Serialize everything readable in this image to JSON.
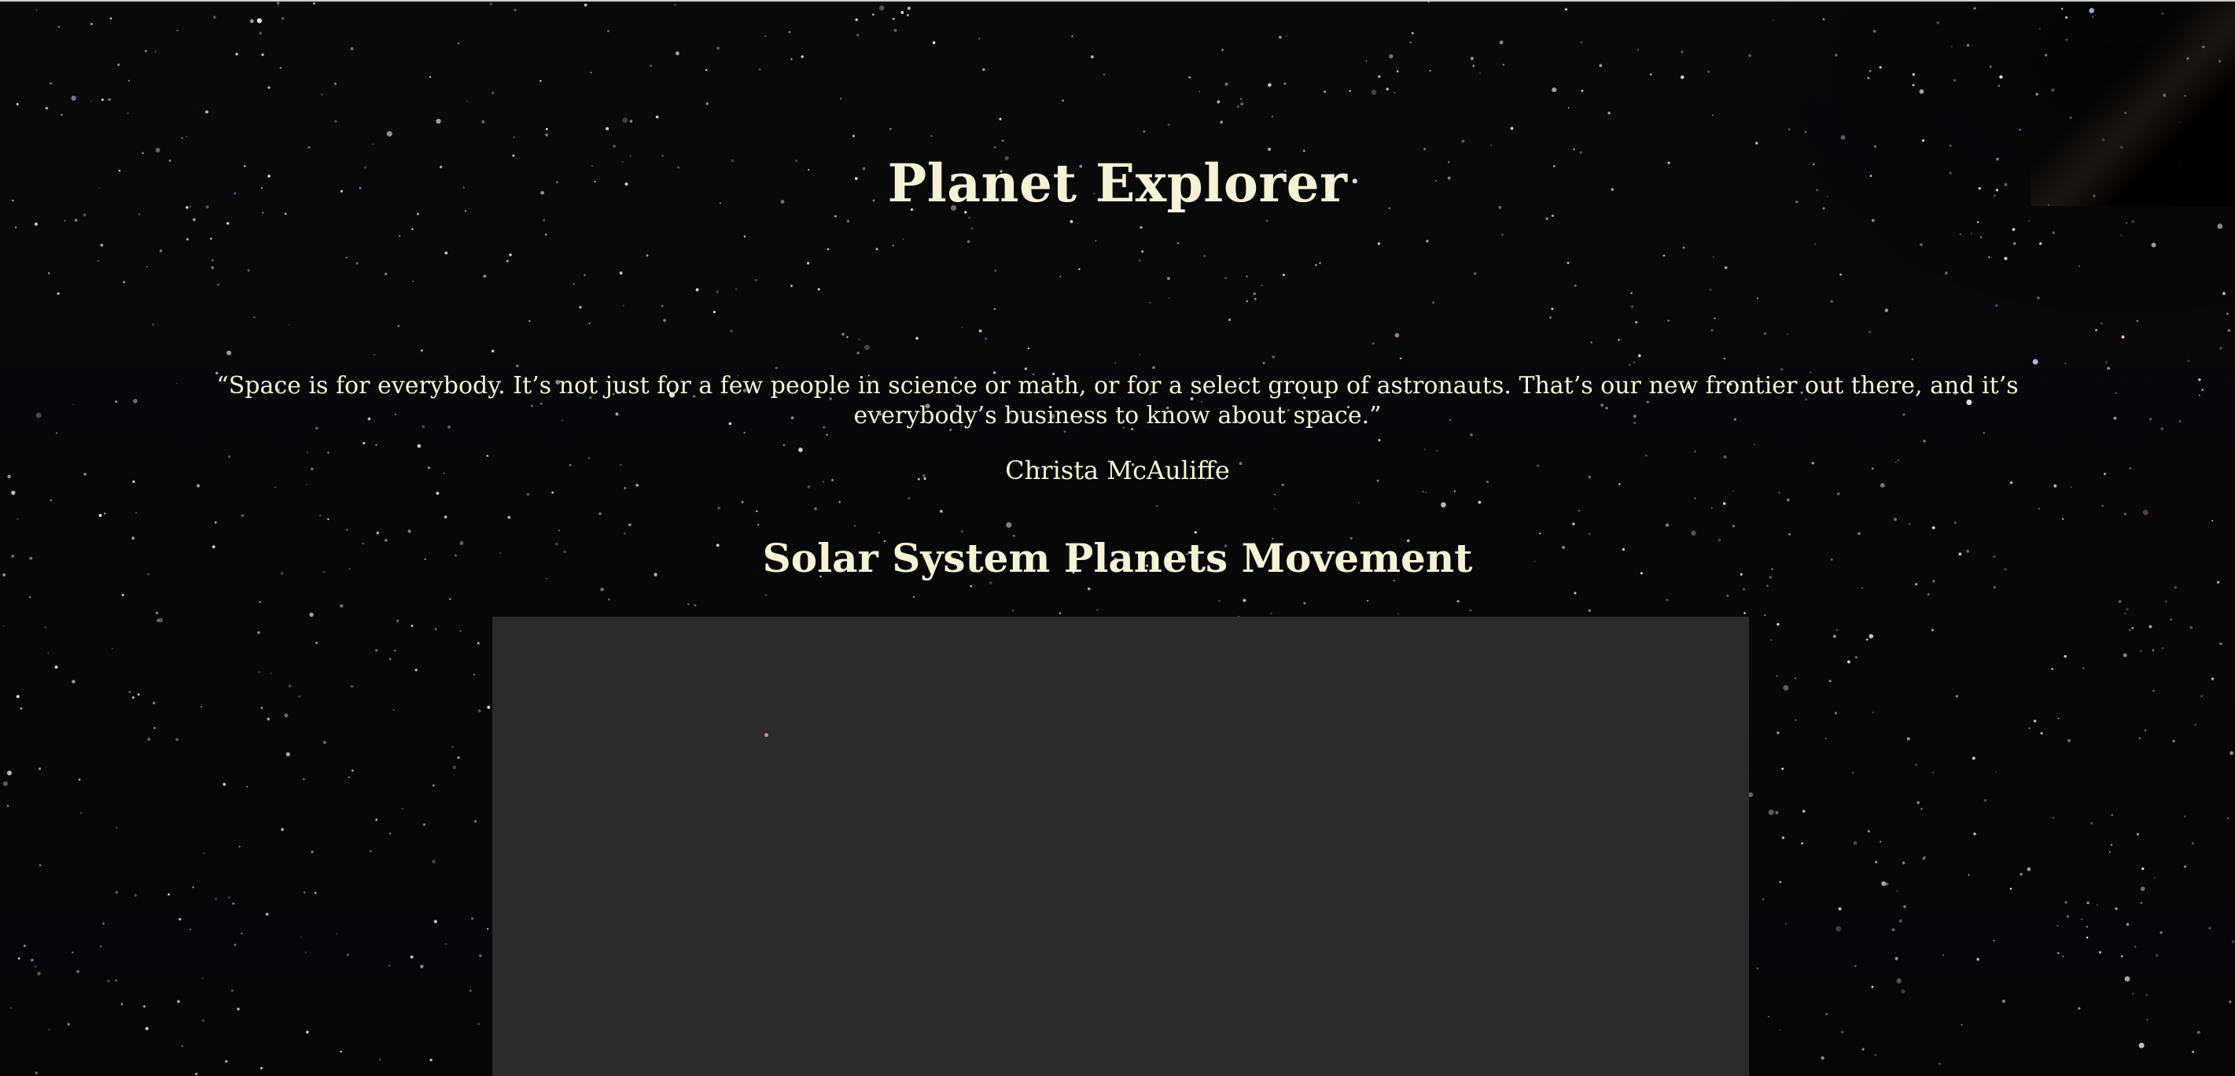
{
  "page": {
    "title": "Planet Explorer",
    "quote": "“Space is for everybody. It’s not just for a few people in science or math, or for a select group of astronauts. That’s our new frontier out there, and it’s everybody’s business to know about space.”",
    "quote_author": "Christa McAuliffe",
    "section_title": "Solar System Planets Movement"
  },
  "colors": {
    "background": "#050505",
    "text": "#f5f2d8",
    "canvas": "#2b2b2b",
    "planet": "#d98a78"
  },
  "icons": {
    "background": "starfield-image"
  }
}
